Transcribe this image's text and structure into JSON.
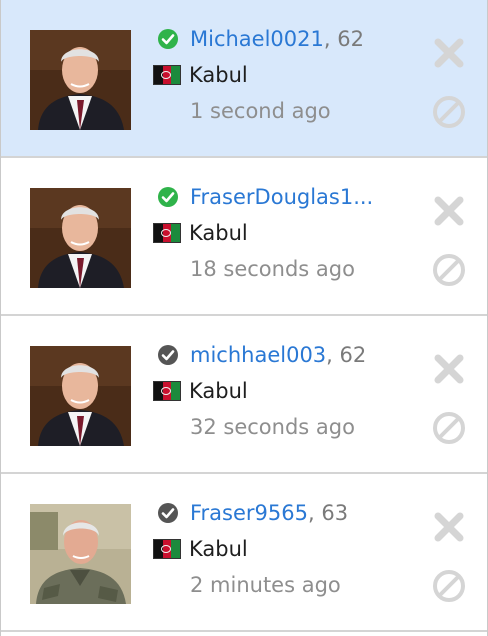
{
  "rows": [
    {
      "username": "Michael0021",
      "age_suffix": ", 62",
      "status": "online",
      "city": "Kabul",
      "time": "1 second ago",
      "photo": "portrait-suit"
    },
    {
      "username": "FraserDouglas1...",
      "age_suffix": "",
      "status": "online",
      "city": "Kabul",
      "time": "18 seconds ago",
      "photo": "portrait-suit"
    },
    {
      "username": "michhael003",
      "age_suffix": ", 62",
      "status": "verified",
      "city": "Kabul",
      "time": "32 seconds ago",
      "photo": "portrait-suit"
    },
    {
      "username": "Fraser9565",
      "age_suffix": ", 63",
      "status": "verified",
      "city": "Kabul",
      "time": "2 minutes ago",
      "photo": "portrait-uniform"
    }
  ],
  "colors": {
    "selected_row": "#d8e8fb",
    "username_link": "#2a78d4",
    "online_check": "#2fb34a",
    "verified_check": "#555555",
    "action_icons": "#d5d5d5"
  },
  "icons": {
    "online": "check-circle-icon",
    "verified": "check-circle-icon",
    "remove": "close-icon",
    "block": "block-icon",
    "flag": "afghanistan-flag-icon"
  }
}
